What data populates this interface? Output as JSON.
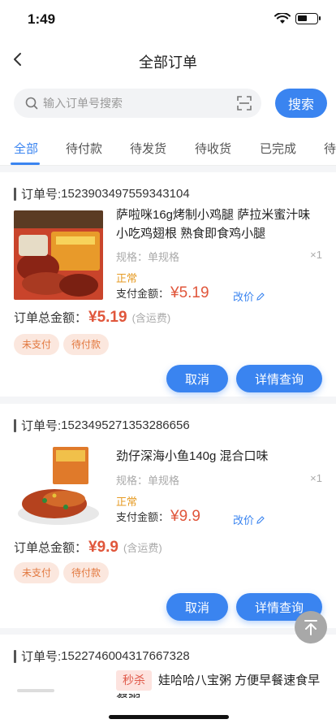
{
  "status_bar": {
    "time": "1:49"
  },
  "nav": {
    "title": "全部订单"
  },
  "search": {
    "placeholder": "输入订单号搜索",
    "button_label": "搜索"
  },
  "tabs": [
    "全部",
    "待付款",
    "待发货",
    "待收货",
    "已完成",
    "待"
  ],
  "active_tab": 0,
  "labels": {
    "order_no_prefix": "订单号:",
    "spec": "规格：单规格",
    "status_normal": "正常",
    "pay_amount_label": "支付金额：",
    "modify_price": "改价",
    "total_label": "订单总金额：",
    "shipping_note": "(含运费)",
    "cancel": "取消",
    "detail": "详情查询",
    "flash_sale": "秒杀"
  },
  "orders": [
    {
      "order_no": "1523903497559343104",
      "title": "萨啦咪16g烤制小鸡腿 萨拉米蜜汁味小吃鸡翅根 熟食即食鸡小腿",
      "qty": "×1",
      "pay_amount": "¥5.19",
      "total_amount": "¥5.19",
      "badges": [
        "未支付",
        "待付款"
      ]
    },
    {
      "order_no": "1523495271353286656",
      "title": "劲仔深海小鱼140g 混合口味",
      "qty": "×1",
      "pay_amount": "¥9.9",
      "total_amount": "¥9.9",
      "badges": [
        "未支付",
        "待付款"
      ]
    },
    {
      "order_no": "1522746004317667328",
      "title": "娃哈哈八宝粥 方便早餐速食早餐粥…"
    }
  ],
  "colors": {
    "accent": "#3a84f0",
    "price": "#e0563b",
    "status": "#e69b24",
    "badge_bg": "#fbe7de",
    "badge_text": "#e2783f"
  }
}
